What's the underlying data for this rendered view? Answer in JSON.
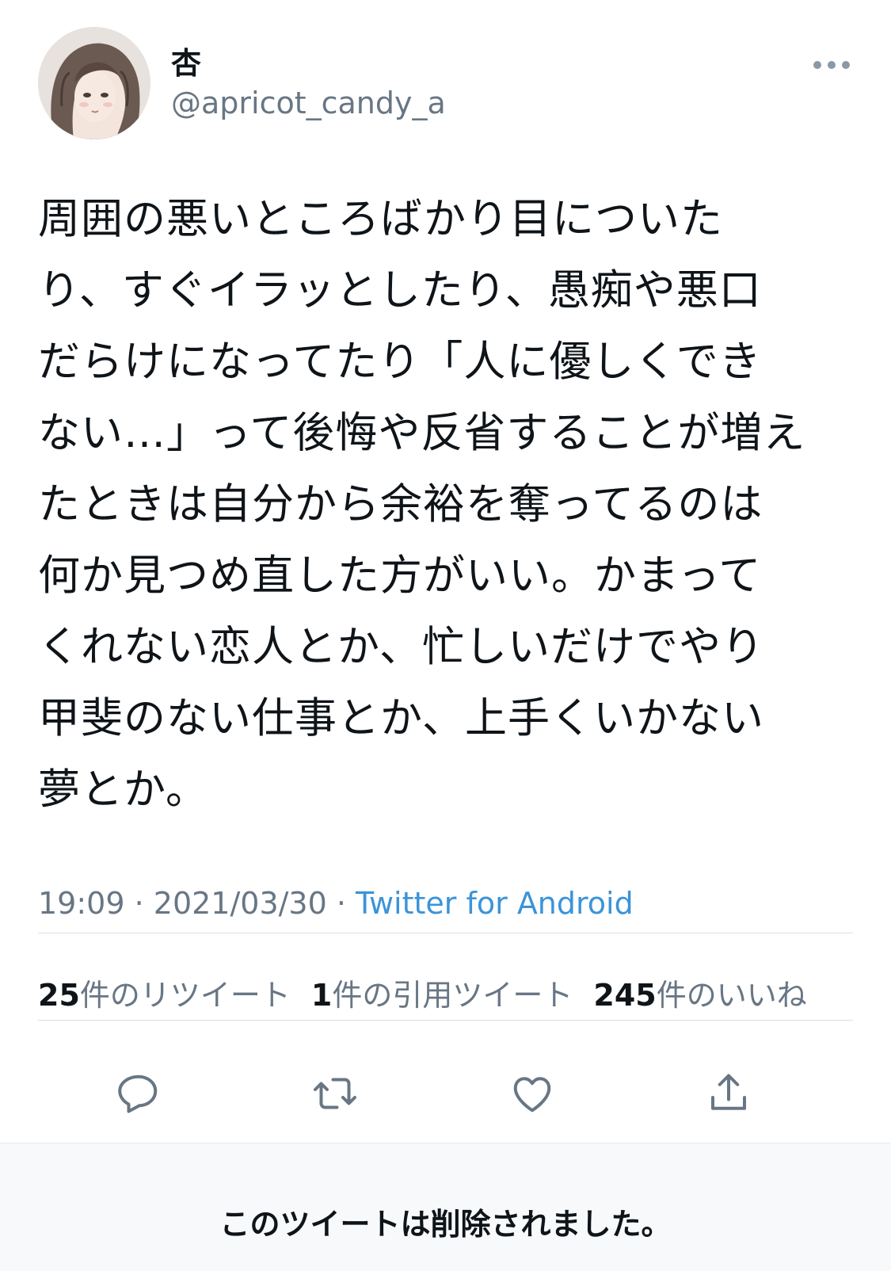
{
  "author": {
    "display_name": "杏",
    "handle": "@apricot_candy_a",
    "avatar_icon": "avatar-illustration-icon"
  },
  "tweet": {
    "text": "周囲の悪いところばかり目についた\nり、すぐイラッとしたり、愚痴や悪口\nだらけになってたり「人に優しくでき\nない…」って後悔や反省することが増え\nたときは自分から余裕を奪ってるのは\n何か見つめ直した方がいい。かまって\nくれない恋人とか、忙しいだけでやり\n甲斐のない仕事とか、上手くいかない\n夢とか。",
    "time": "19:09",
    "date": "2021/03/30",
    "separator": " · ",
    "source": "Twitter for Android"
  },
  "stats": {
    "retweets_count": "25",
    "retweets_label": "件のリツイート",
    "quotes_count": "1",
    "quotes_label": "件の引用ツイート",
    "likes_count": "245",
    "likes_label": "件のいいね"
  },
  "actions": [
    {
      "icon": "reply-icon"
    },
    {
      "icon": "retweet-icon"
    },
    {
      "icon": "like-icon"
    },
    {
      "icon": "share-icon"
    }
  ],
  "deleted_notice": "このツイートは削除されました。",
  "colors": {
    "text": "#0f1419",
    "secondary": "#687684",
    "link": "#3b94d9",
    "divider": "#dadfe3",
    "panel_bg": "#f7f9fa"
  }
}
